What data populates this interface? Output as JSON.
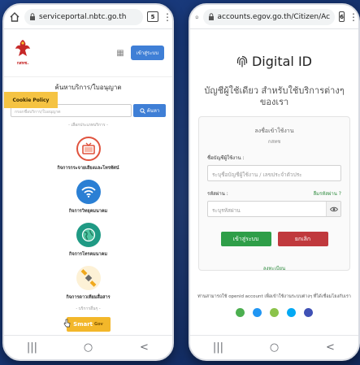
{
  "left_phone": {
    "url": "serviceportal.nbtc.go.th",
    "tab_count": "5",
    "logo_text": "กสทช.",
    "login_label": "เข้าสู่ระบบ",
    "section_title": "ค้นหาบริการ/ใบอนุญาต",
    "cookie_label": "Cookie Policy",
    "search_placeholder": "กรอกชื่อบริการ/ใบอนุญาต",
    "search_button": "ค้นหา",
    "category_label": "- เลือกประเภทบริการ -",
    "services": [
      {
        "label": "กิจการกระจายเสียงและโทรทัศน์",
        "icon": "tv-icon",
        "color": "#e0533e"
      },
      {
        "label": "กิจการวิทยุคมนาคม",
        "icon": "wifi-icon",
        "color": "#2a7fd4"
      },
      {
        "label": "กิจการโทรคมนาคม",
        "icon": "globe-icon",
        "color": "#1f9a84"
      },
      {
        "label": "กิจการดาวเทียมสื่อสาร",
        "icon": "satellite-icon",
        "color": "#f0a81c"
      }
    ],
    "more_label": "- บริการอื่นๆ -",
    "smart_label": "Smart",
    "smart_sub": "Gov"
  },
  "right_phone": {
    "url": "accounts.egov.go.th/Citizen/Ac",
    "tab_count": "6",
    "brand": "Digital ID",
    "headline": "บัญชีผู้ใช้เดียว สำหรับใช้บริการต่างๆ ของเรา",
    "card_title": "ลงชื่อเข้าใช้งาน",
    "card_sub": "กสทช",
    "username_label": "ชื่อบัญชีผู้ใช้งาน :",
    "username_placeholder": "ระบุชื่อบัญชีผู้ใช้งาน / เลขประจำตัวประ",
    "password_label": "รหัสผ่าน :",
    "forgot_label": "ลืมรหัสผ่าน ?",
    "password_placeholder": "ระบุรหัสผ่าน",
    "login_button": "เข้าสู่ระบบ",
    "cancel_button": "ยกเลิก",
    "register_label": "ลงทะเบียน",
    "openid_text": "ท่านสามารถใช้ openid account เพื่อเข้าใช้งานระบบต่างๆ ที่ได้เชื่อมโยงกับเรา",
    "providers": [
      "#4caf50",
      "#2196f3",
      "#8bc34a",
      "#03a9f4",
      "#3f51b5"
    ]
  },
  "nav": {
    "recent": "|||",
    "home": "○",
    "back": "<"
  }
}
